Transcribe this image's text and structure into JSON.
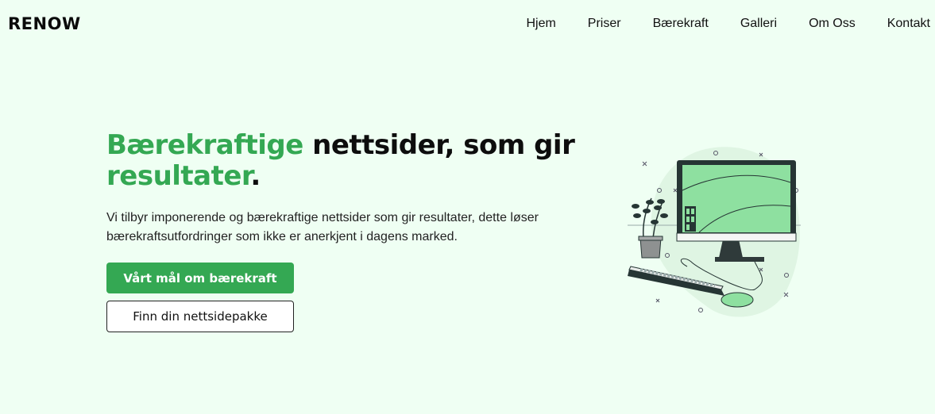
{
  "brand": {
    "logo_text": "RENOW"
  },
  "nav": {
    "items": [
      {
        "label": "Hjem"
      },
      {
        "label": "Priser"
      },
      {
        "label": "Bærekraft"
      },
      {
        "label": "Galleri"
      },
      {
        "label": "Om Oss"
      },
      {
        "label": "Kontakt"
      }
    ]
  },
  "hero": {
    "title_highlight_1": "Bærekraftige",
    "title_plain": " nettsider, som gir ",
    "title_highlight_2": "resultater",
    "title_end": ".",
    "description": "Vi tilbyr imponerende og bærekraftige nettsider som gir resultater, dette løser bærekraftsutfordringer som ikke er anerkjent i dagens marked.",
    "primary_button": "Vårt mål om bærekraft",
    "secondary_button": "Finn din nettsidepakke"
  },
  "colors": {
    "background": "#effff3",
    "accent": "#34a853",
    "text": "#111111"
  },
  "illustration": {
    "name": "desktop-computer-with-plant-illustration"
  }
}
